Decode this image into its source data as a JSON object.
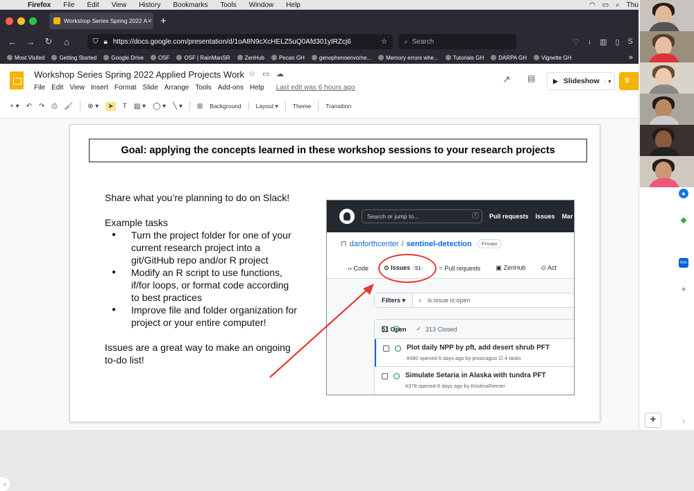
{
  "macbar": {
    "app": "Firefox",
    "menus": [
      "File",
      "Edit",
      "View",
      "History",
      "Bookmarks",
      "Tools",
      "Window",
      "Help"
    ],
    "day": "Thu",
    "battery_icon": "battery-icon",
    "wifi_icon": "wifi-icon"
  },
  "browser": {
    "tab_title": "Workshop Series Spring 2022 A",
    "url": "https://docs.google.com/presentation/d/1oA8N9cXcHELZ5uQ0Afd301yIRZcj6",
    "search_placeholder": "Search",
    "bookmarks": [
      "Most Visited",
      "Getting Started",
      "Google Drive",
      "OSF",
      "OSF | RainManSR",
      "ZenHub",
      "Pecan GH",
      "genophenoenvo/ne...",
      "Memory errors whe...",
      "Tutorials GH",
      "DARPA GH",
      "Vignette GH"
    ]
  },
  "docs": {
    "title": "Workshop Series Spring 2022 Applied Projects Work",
    "menus": [
      "File",
      "Edit",
      "View",
      "Insert",
      "Format",
      "Slide",
      "Arrange",
      "Tools",
      "Add-ons",
      "Help"
    ],
    "last_edit": "Last edit was 6 hours ago",
    "slideshow_label": "Slideshow",
    "share_label": "S",
    "toolbar": {
      "background": "Background",
      "layout": "Layout",
      "theme": "Theme",
      "transition": "Transition"
    }
  },
  "slide": {
    "goal": "Goal: applying the concepts learned in these workshop sessions to your research projects",
    "intro": "Share what you’re planning to do on Slack!",
    "tasks_heading": "Example tasks",
    "tasks": [
      "Turn the project folder for one of your current research project into a git/GitHub repo and/or R project",
      "Modify an R script to use functions, if/for loops, or format code according to best practices",
      "Improve file and folder organization for project or your entire computer!"
    ],
    "closing": "Issues are a great way to make an ongoing to-do list!",
    "annotation_color": "#e53935"
  },
  "github": {
    "search": "Search or jump to...",
    "search_key": "/",
    "nav": [
      "Pull requests",
      "Issues",
      "Mar"
    ],
    "owner": "danforthcenter",
    "repo": "sentinel-detection",
    "visibility": "Private",
    "tabs": [
      {
        "label": "Code"
      },
      {
        "label": "Issues",
        "count": "51"
      },
      {
        "label": "Pull requests"
      },
      {
        "label": "ZenHub"
      },
      {
        "label": "Act"
      }
    ],
    "filters_label": "Filters",
    "query": "is:issue is:open",
    "open_count": "51 Open",
    "closed_count": "313 Closed",
    "issues": [
      {
        "title": "Plot daily NPP by pft, add desert shrub PFT",
        "meta": "#380 opened 6 days ago by jessicaguo",
        "tasks": "4 tasks"
      },
      {
        "title": "Simulate Setaria in Alaska with tundra PFT",
        "meta": "#378 opened 8 days ago by KristinaRiemer"
      }
    ]
  }
}
